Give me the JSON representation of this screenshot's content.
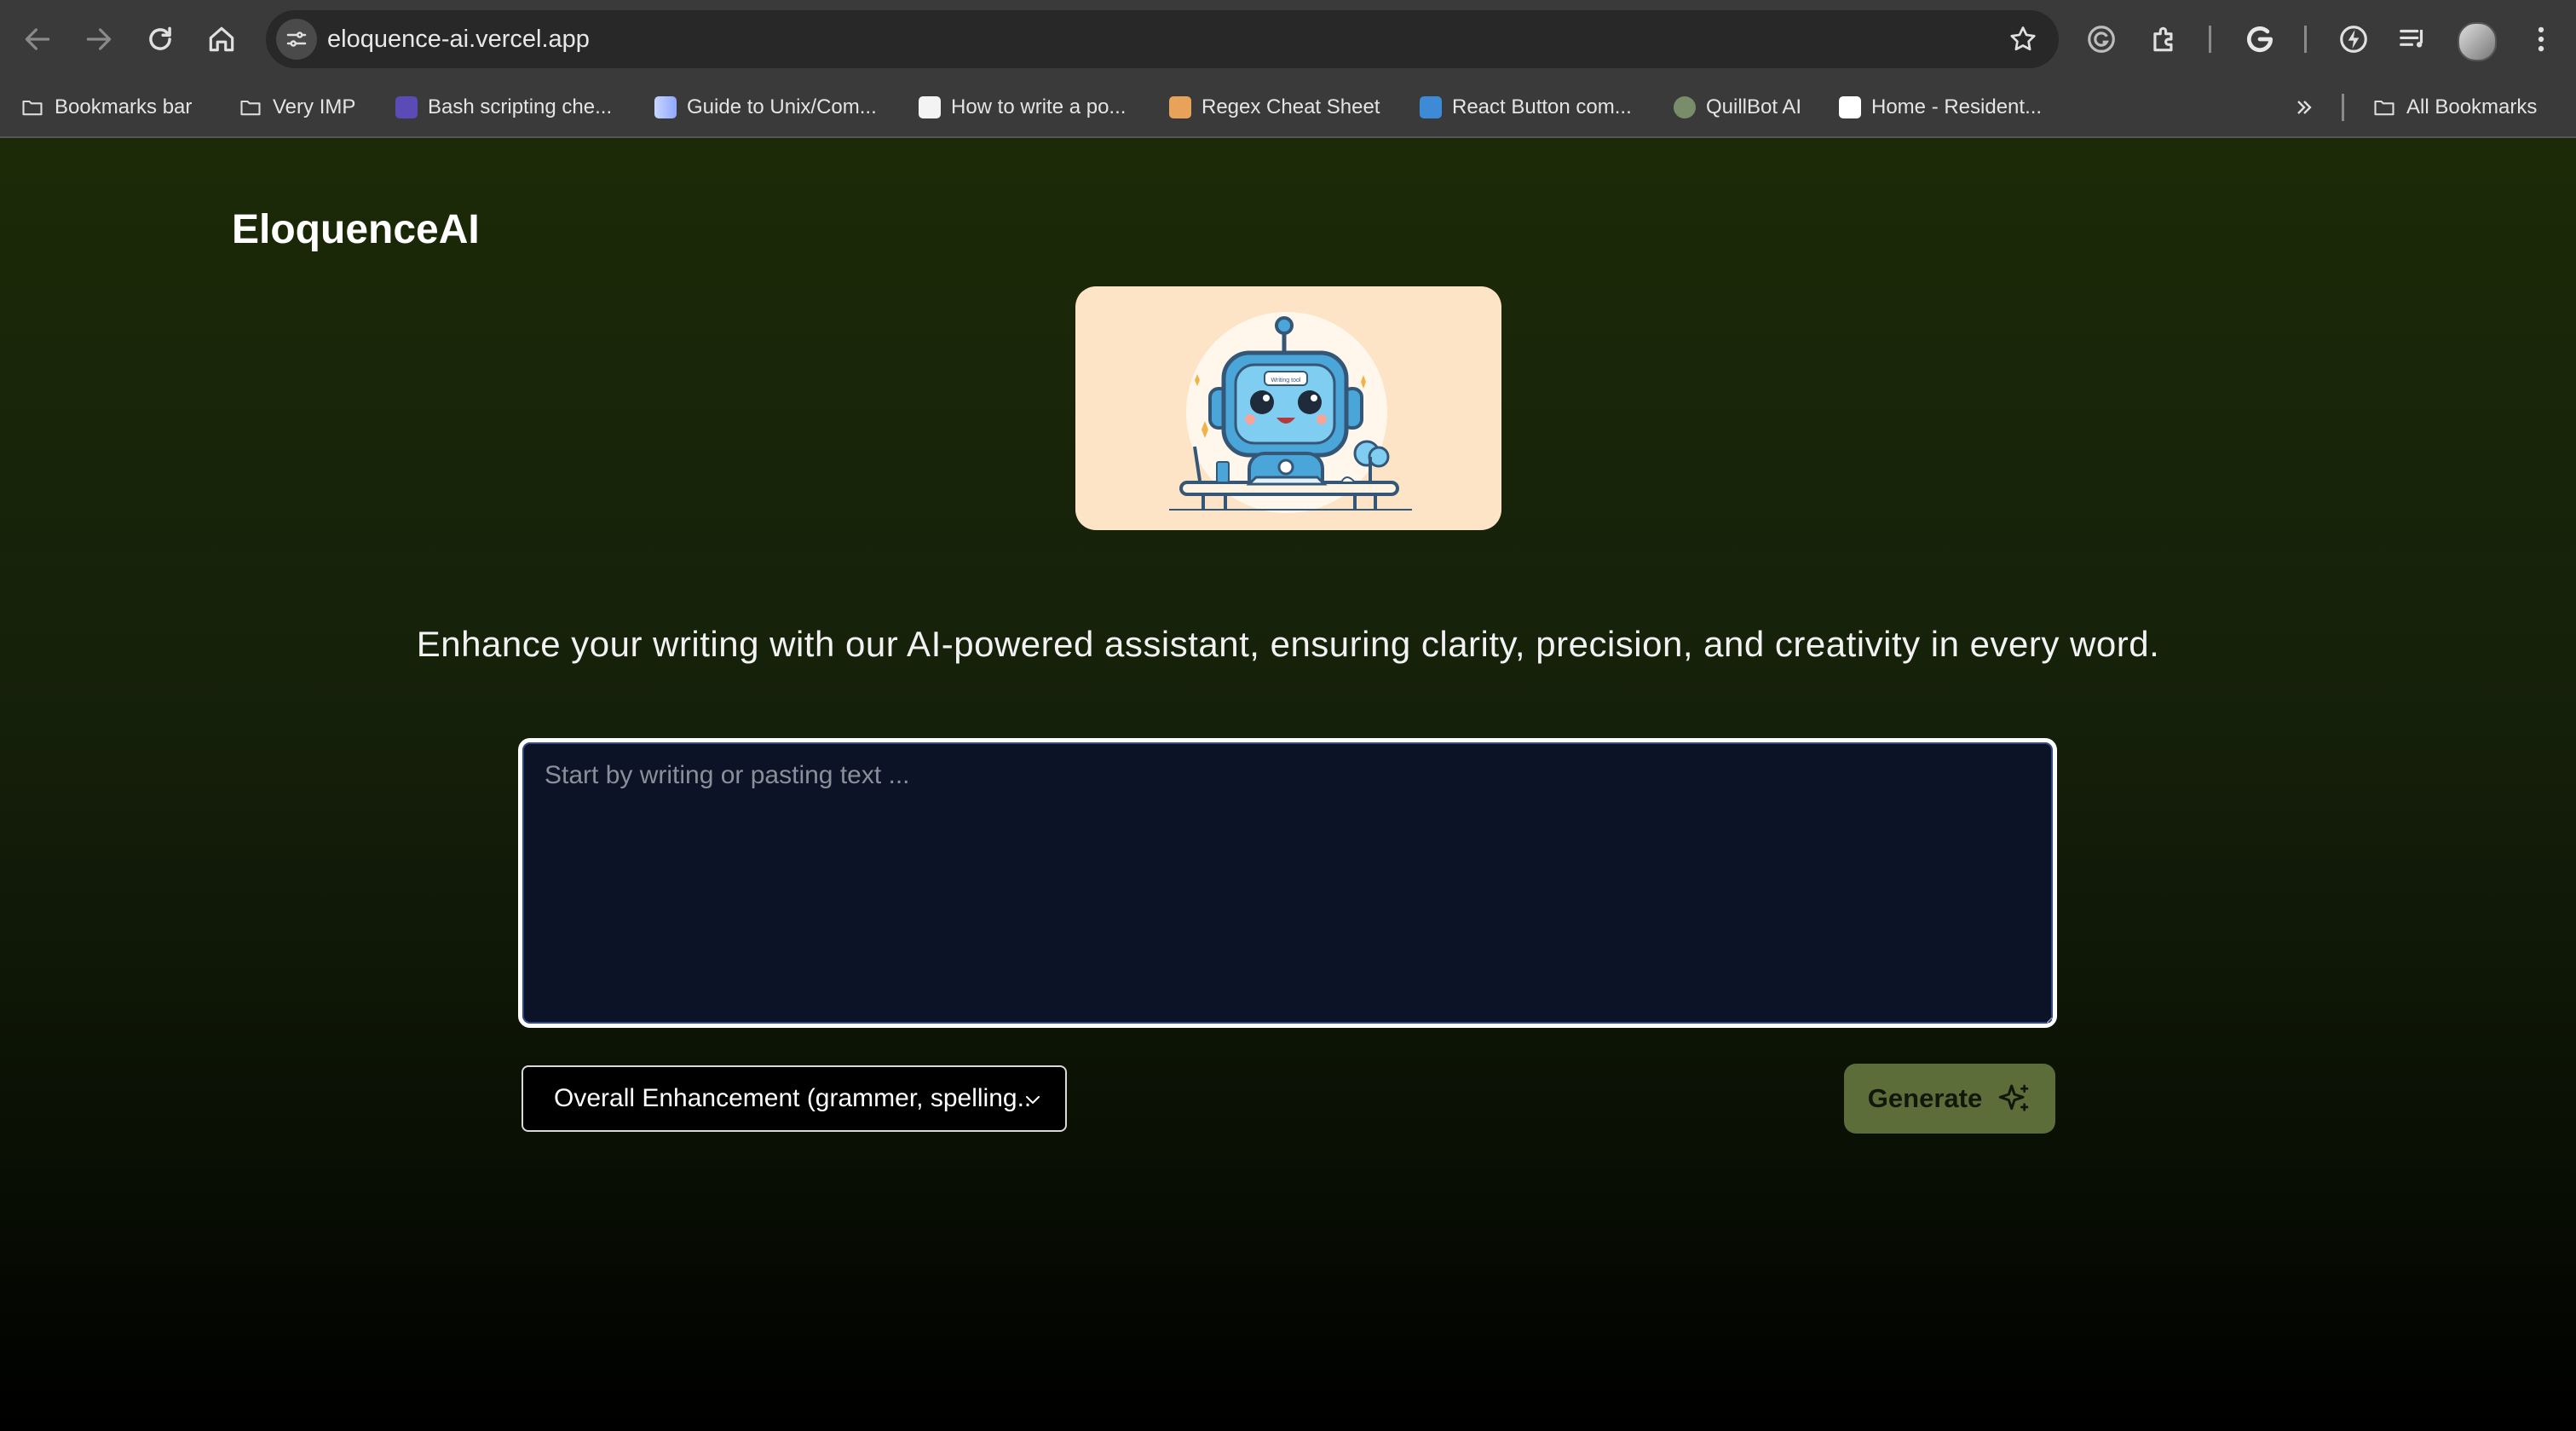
{
  "browser": {
    "url": "eloquence-ai.vercel.app",
    "bookmarks": [
      {
        "label": "Bookmarks bar",
        "icon": "folder-icon"
      },
      {
        "label": "Very IMP",
        "icon": "folder-icon"
      },
      {
        "label": "Bash scripting che...",
        "icon": "bash-favicon"
      },
      {
        "label": "Guide to Unix/Com...",
        "icon": "guide-favicon"
      },
      {
        "label": "How to write a po...",
        "icon": "howto-favicon"
      },
      {
        "label": "Regex Cheat Sheet",
        "icon": "regex-favicon"
      },
      {
        "label": "React Button com...",
        "icon": "react-favicon"
      },
      {
        "label": "QuillBot AI",
        "icon": "quillbot-favicon"
      },
      {
        "label": "Home - Resident...",
        "icon": "home-favicon"
      }
    ],
    "all_bookmarks": "All Bookmarks"
  },
  "app": {
    "brand": "EloquenceAI",
    "tagline": "Enhance your writing with our AI-powered assistant, ensuring clarity, precision, and creativity in every word.",
    "editor_placeholder": "Start by writing or pasting text ...",
    "mode_selected": "Overall Enhancement (grammer, spelling..",
    "generate_label": "Generate",
    "robot_screen_text": "Writing tool"
  },
  "colors": {
    "accent_green": "#5d6d3a",
    "hero_bg": "#fde4c6",
    "editor_bg": "#0d1326"
  }
}
